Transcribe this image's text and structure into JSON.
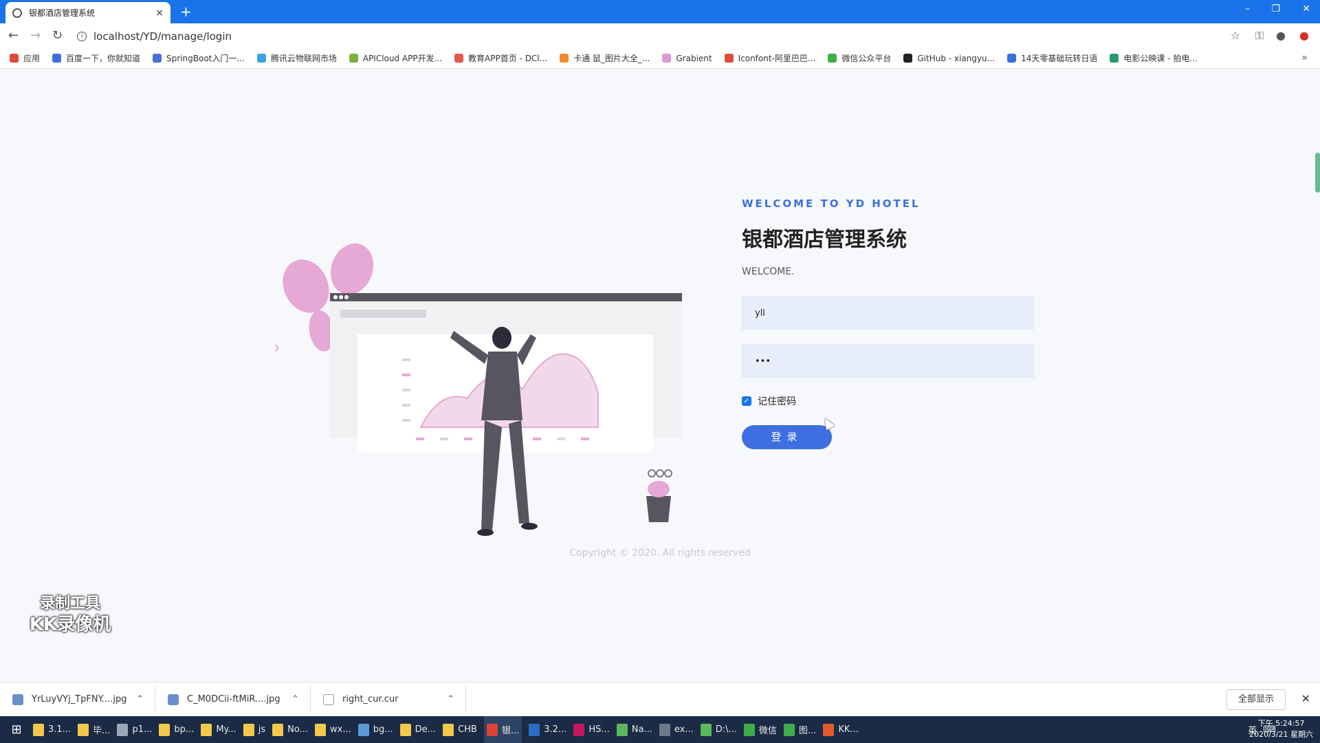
{
  "browser": {
    "tab_title": "银都酒店管理系统",
    "tab_close": "×",
    "new_tab": "+",
    "url": "localhost/YD/manage/login",
    "window_controls": [
      "–",
      "❐",
      "✕"
    ],
    "nav": {
      "back": "←",
      "forward": "→",
      "reload": "↻"
    },
    "bookmarks": [
      {
        "label": "应用",
        "color": "#e04a3a"
      },
      {
        "label": "百度一下，你就知道",
        "color": "#3b6fe0"
      },
      {
        "label": "SpringBoot入门一...",
        "color": "#4a6fd6"
      },
      {
        "label": "腾讯云物联网市场",
        "color": "#3aa0e0"
      },
      {
        "label": "APICloud APP开发...",
        "color": "#7fb23a"
      },
      {
        "label": "教育APP首页 - DCl...",
        "color": "#e05a4a"
      },
      {
        "label": "卡通 鼠_图片大全_...",
        "color": "#f08c2a"
      },
      {
        "label": "Grabient",
        "color": "#d99ad6"
      },
      {
        "label": "Iconfont-阿里巴巴...",
        "color": "#e04a3a"
      },
      {
        "label": "微信公众平台",
        "color": "#3fae4a"
      },
      {
        "label": "GitHub - xiangyu...",
        "color": "#222222"
      },
      {
        "label": "14天零基础玩转日语",
        "color": "#3b6fe0"
      },
      {
        "label": "电影公映课 - 拍电...",
        "color": "#2a9a6a"
      }
    ],
    "bookmarks_more": "»"
  },
  "login": {
    "welcome_en": "WELCOME TO YD HOTEL",
    "title": "银都酒店管理系统",
    "welcome": "WELCOME.",
    "username_value": "yll",
    "password_value": "•••",
    "remember_label": "记住密码",
    "remember_checked": true,
    "submit_label": "登录",
    "accent_color": "#3d6fe0"
  },
  "copyright": "Copyright © 2020. All rights reserved",
  "watermark": {
    "line1": "录制工具",
    "line2": "KK录像机"
  },
  "downloads": {
    "items": [
      {
        "name": "YrLuyVYj_TpFNY....jpg"
      },
      {
        "name": "C_M0DCii-ftMiR....jpg"
      },
      {
        "name": "right_cur.cur"
      }
    ],
    "show_all": "全部显示",
    "close": "✕"
  },
  "taskbar": {
    "items": [
      {
        "label": "3.1...",
        "color": "#f2c94c"
      },
      {
        "label": "毕...",
        "color": "#f2c94c"
      },
      {
        "label": "p1...",
        "color": "#9aa7b8"
      },
      {
        "label": "bp...",
        "color": "#f2c94c"
      },
      {
        "label": "My...",
        "color": "#f2c94c"
      },
      {
        "label": "js",
        "color": "#f2c94c"
      },
      {
        "label": "No...",
        "color": "#f2c94c"
      },
      {
        "label": "wx...",
        "color": "#f2c94c"
      },
      {
        "label": "bg...",
        "color": "#5b9bd5"
      },
      {
        "label": "De...",
        "color": "#f2c94c"
      },
      {
        "label": "CHB",
        "color": "#f2c94c"
      },
      {
        "label": "银...",
        "color": "#db4437",
        "active": true
      },
      {
        "label": "3.2...",
        "color": "#2b6cc4"
      },
      {
        "label": "HS...",
        "color": "#c2185b"
      },
      {
        "label": "Na...",
        "color": "#5cb85c"
      },
      {
        "label": "ex...",
        "color": "#6c7a89"
      },
      {
        "label": "D:\\...",
        "color": "#5cb85c"
      },
      {
        "label": "微信",
        "color": "#3fae4a"
      },
      {
        "label": "图...",
        "color": "#3fae4a"
      },
      {
        "label": "KK...",
        "color": "#e05a2a"
      }
    ],
    "tray": [
      "英",
      "⌨"
    ],
    "time": "下午 5:24:57",
    "date": "2020/3/21 星期六"
  }
}
